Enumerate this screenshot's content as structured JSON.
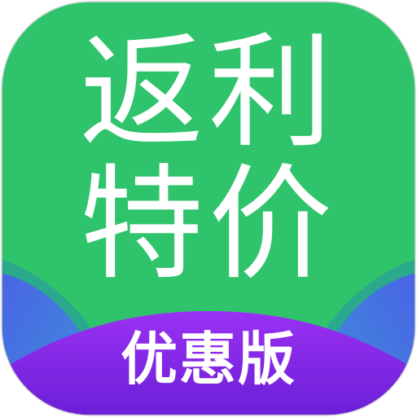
{
  "app_icon": {
    "title_line1": "返利",
    "title_line2": "特价",
    "subtitle": "优惠版"
  },
  "colors": {
    "background_green": "#2fc46b",
    "purple_banner_top": "#8f2df0",
    "purple_banner_bottom": "#6d1fd8",
    "blue_wave": "#3f6fe0",
    "teal_wave": "#26b08e",
    "text": "#ffffff",
    "outer_background": "#ffffff"
  }
}
